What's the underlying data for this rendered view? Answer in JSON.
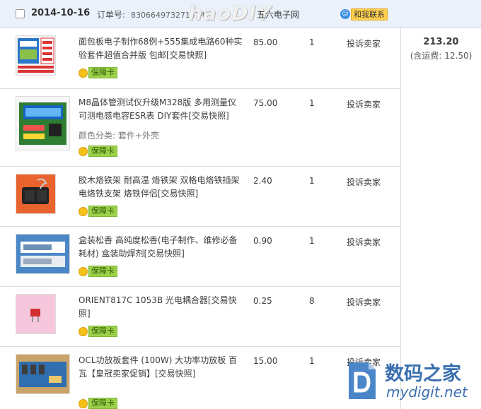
{
  "order": {
    "date": "2014-10-16",
    "number_label": "订单号:",
    "number": "830664973271414",
    "watermark": "haoDIY",
    "shop": "五六电子网",
    "contact_label": "和我联系",
    "contact_icon": "wangwang-chat-icon",
    "total": "213.20",
    "shipping": "(含运费: 12.50)"
  },
  "items": [
    {
      "title": "面包板电子制作68例+555集成电路60种实验套件超值合并版 包邮[交易快照]",
      "spec": "",
      "price": "85.00",
      "qty": "1",
      "report": "投诉卖家",
      "badge": "保障卡"
    },
    {
      "title": "M8晶体管测试仪升级M328版 多用测量仪 可测电感电容ESR表 DIY套件[交易快照]",
      "spec": "颜色分类: 套件+外壳",
      "price": "75.00",
      "qty": "1",
      "report": "投诉卖家",
      "badge": "保障卡"
    },
    {
      "title": "胶木烙铁架 耐高温 烙铁架 双格电烙铁插架 电烙铁支架 烙铁伴侣[交易快照]",
      "spec": "",
      "price": "2.40",
      "qty": "1",
      "report": "投诉卖家",
      "badge": "保障卡"
    },
    {
      "title": "盒装松香 高纯度松香(电子制作、维修必备耗材) 盒装助焊剂[交易快照]",
      "spec": "",
      "price": "0.90",
      "qty": "1",
      "report": "投诉卖家",
      "badge": "保障卡"
    },
    {
      "title": "ORIENT817C 1053B 光电耦合器[交易快照]",
      "spec": "",
      "price": "0.25",
      "qty": "8",
      "report": "投诉卖家",
      "badge": "保障卡"
    },
    {
      "title": "OCL功放板套件 (100W) 大功率功放板 百瓦【皇冠卖家促销】[交易快照]",
      "spec": "",
      "price": "15.00",
      "qty": "1",
      "report": "投诉卖家",
      "badge": "保障卡"
    }
  ],
  "logo": {
    "line1": "数码之家",
    "line2": "mydigit.net"
  },
  "colors": {
    "header_bg": "#eaf1fb",
    "badge_green": "#9ed14a",
    "contact_yellow": "#ffcf4f",
    "logo_blue": "#3a6fb0"
  }
}
